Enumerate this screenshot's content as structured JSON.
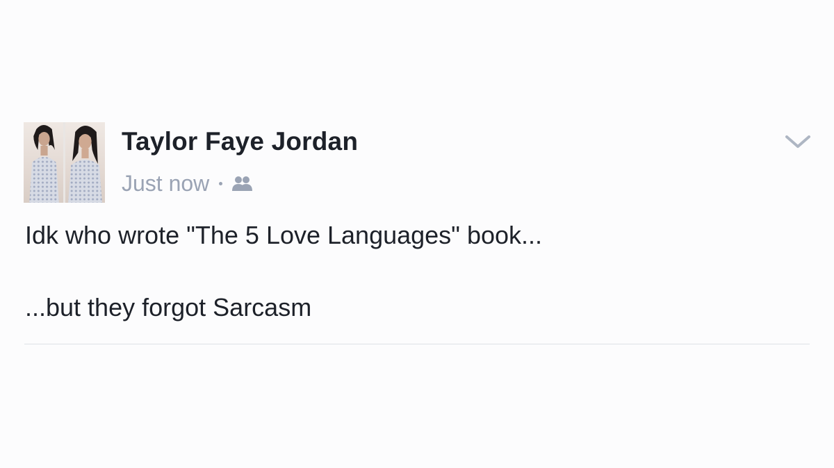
{
  "post": {
    "author_name": "Taylor Faye Jordan",
    "timestamp": "Just now",
    "separator": "·",
    "audience_icon": "friends-icon",
    "menu_icon": "chevron-down-icon",
    "body_lines": [
      "Idk who wrote \"The 5 Love Languages\" book...",
      "...but they forgot Sarcasm"
    ]
  },
  "colors": {
    "background": "#fcfcfd",
    "name_text": "#1d2129",
    "meta_text": "#9aa3b4",
    "divider": "#dde0e6",
    "chevron": "#aeb6c3"
  }
}
